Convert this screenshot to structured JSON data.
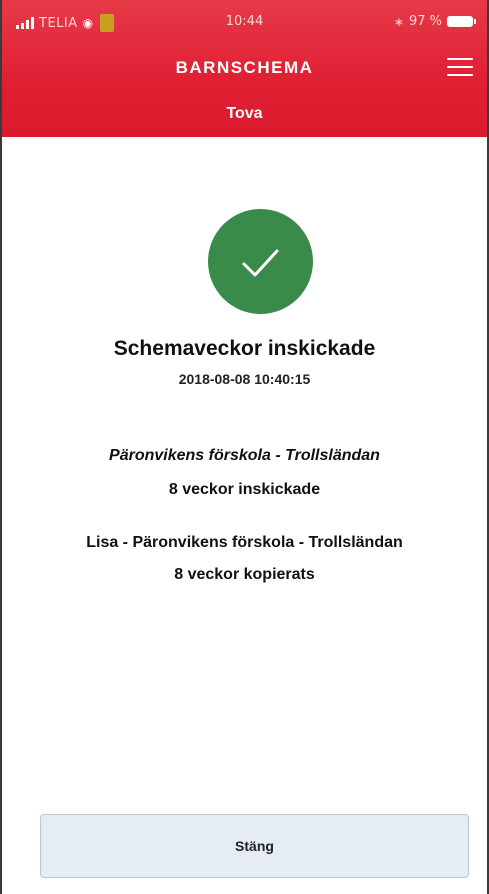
{
  "status_bar": {
    "carrier": "TELIA",
    "time": "10:44",
    "battery": "97 %"
  },
  "header": {
    "title": "BARNSCHEMA",
    "child_name": "Tova"
  },
  "confirmation": {
    "title": "Schemaveckor inskickade",
    "timestamp": "2018-08-08 10:40:15",
    "status": "success",
    "badge_color": "#3a8a4a"
  },
  "results": [
    {
      "name": "Päronvikens förskola - Trollsländan",
      "status": "8 veckor inskickade",
      "italic": true
    },
    {
      "name": "Lisa - Päronvikens förskola - Trollsländan",
      "status": "8 veckor kopierats",
      "italic": false
    }
  ],
  "footer": {
    "close_label": "Stäng"
  },
  "colors": {
    "header": "#e01f33",
    "success": "#3a8a4a"
  }
}
